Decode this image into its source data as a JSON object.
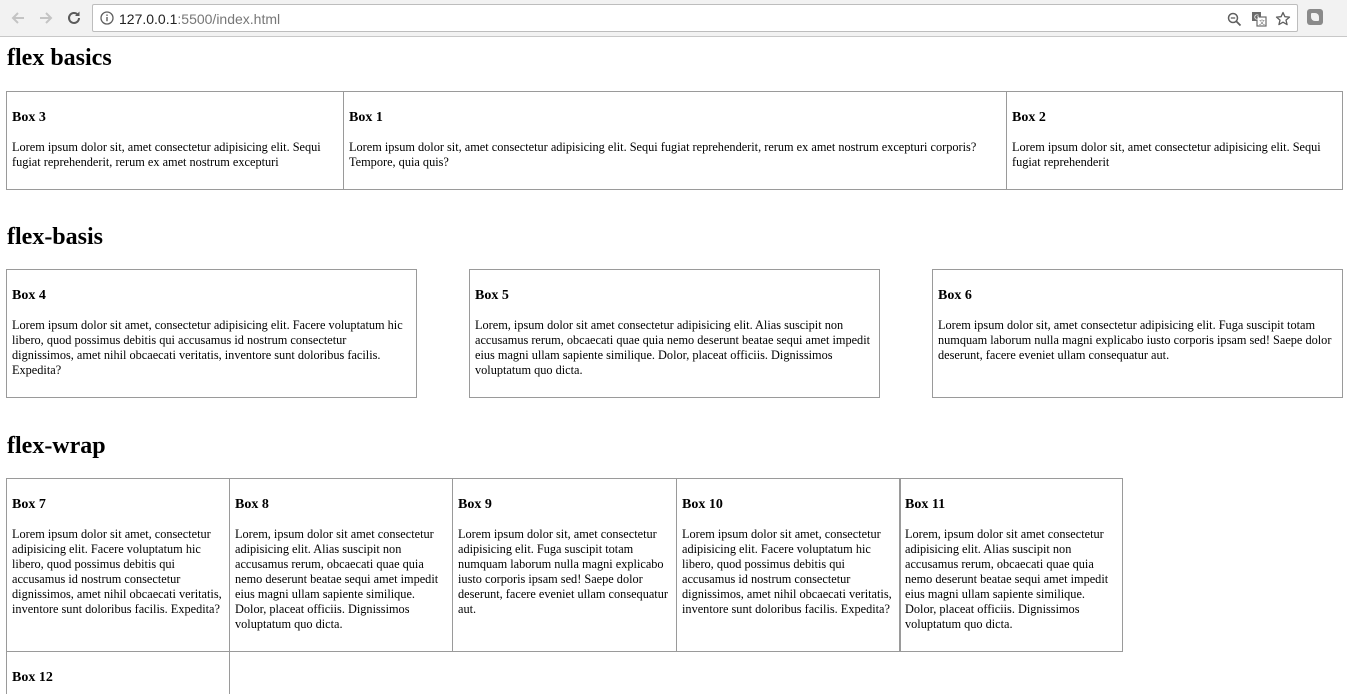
{
  "browser": {
    "url_host": "127.0.0.1",
    "url_rest": ":5500/index.html"
  },
  "sections": [
    {
      "heading": "flex basics",
      "boxes": [
        {
          "title": "Box 3",
          "text": "Lorem ipsum dolor sit, amet consectetur adipisicing elit. Sequi fugiat reprehenderit, rerum ex amet nostrum excepturi"
        },
        {
          "title": "Box 1",
          "text": "Lorem ipsum dolor sit, amet consectetur adipisicing elit. Sequi fugiat reprehenderit, rerum ex amet nostrum excepturi corporis? Tempore, quia quis?"
        },
        {
          "title": "Box 2",
          "text": "Lorem ipsum dolor sit, amet consectetur adipisicing elit. Sequi fugiat reprehenderit"
        }
      ]
    },
    {
      "heading": "flex-basis",
      "boxes": [
        {
          "title": "Box 4",
          "text": "Lorem ipsum dolor sit amet, consectetur adipisicing elit. Facere voluptatum hic libero, quod possimus debitis qui accusamus id nostrum consectetur dignissimos, amet nihil obcaecati veritatis, inventore sunt doloribus facilis. Expedita?"
        },
        {
          "title": "Box 5",
          "text": "Lorem, ipsum dolor sit amet consectetur adipisicing elit. Alias suscipit non accusamus rerum, obcaecati quae quia nemo deserunt beatae sequi amet impedit eius magni ullam sapiente similique. Dolor, placeat officiis. Dignissimos voluptatum quo dicta."
        },
        {
          "title": "Box 6",
          "text": "Lorem ipsum dolor sit, amet consectetur adipisicing elit. Fuga suscipit totam numquam laborum nulla magni explicabo iusto corporis ipsam sed! Saepe dolor deserunt, facere eveniet ullam consequatur aut."
        }
      ]
    },
    {
      "heading": "flex-wrap",
      "boxes": [
        {
          "title": "Box 7",
          "text": "Lorem ipsum dolor sit amet, consectetur adipisicing elit. Facere voluptatum hic libero, quod possimus debitis qui accusamus id nostrum consectetur dignissimos, amet nihil obcaecati veritatis, inventore sunt doloribus facilis. Expedita?"
        },
        {
          "title": "Box 8",
          "text": "Lorem, ipsum dolor sit amet consectetur adipisicing elit. Alias suscipit non accusamus rerum, obcaecati quae quia nemo deserunt beatae sequi amet impedit eius magni ullam sapiente similique. Dolor, placeat officiis. Dignissimos voluptatum quo dicta."
        },
        {
          "title": "Box 9",
          "text": "Lorem ipsum dolor sit, amet consectetur adipisicing elit. Fuga suscipit totam numquam laborum nulla magni explicabo iusto corporis ipsam sed! Saepe dolor deserunt, facere eveniet ullam consequatur aut."
        },
        {
          "title": "Box 10",
          "text": "Lorem ipsum dolor sit amet, consectetur adipisicing elit. Facere voluptatum hic libero, quod possimus debitis qui accusamus id nostrum consectetur dignissimos, amet nihil obcaecati veritatis, inventore sunt doloribus facilis. Expedita?"
        },
        {
          "title": "Box 11",
          "text": "Lorem, ipsum dolor sit amet consectetur adipisicing elit. Alias suscipit non accusamus rerum, obcaecati quae quia nemo deserunt beatae sequi amet impedit eius magni ullam sapiente similique. Dolor, placeat officiis. Dignissimos voluptatum quo dicta."
        },
        {
          "title": "Box 12",
          "text": ""
        }
      ]
    }
  ]
}
